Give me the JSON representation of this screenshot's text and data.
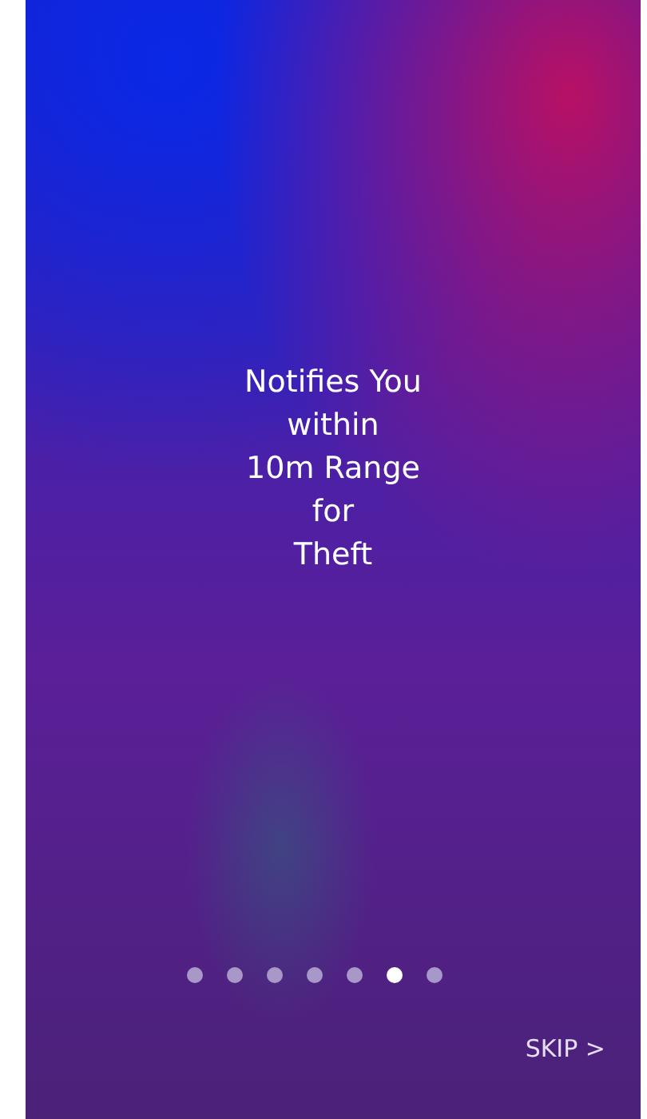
{
  "slide": {
    "title_lines": [
      "Notifies You",
      "within",
      "10m Range",
      "for",
      "Theft"
    ]
  },
  "pager": {
    "dots": [
      {
        "selected": false
      },
      {
        "selected": false
      },
      {
        "selected": false
      },
      {
        "selected": false
      },
      {
        "selected": false
      },
      {
        "selected": true
      },
      {
        "selected": false
      }
    ]
  },
  "skip_button": {
    "label": "SKIP >"
  }
}
